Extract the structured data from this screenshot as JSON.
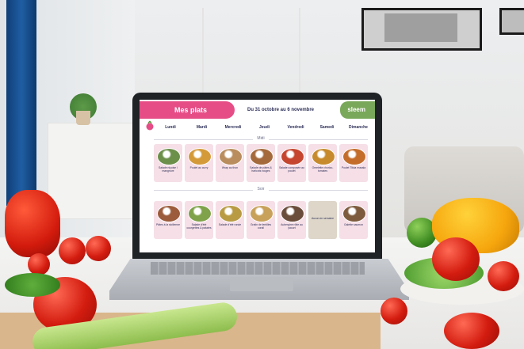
{
  "app": {
    "title": "Mes plats",
    "date_range": "Du 31 octobre au 6 novembre",
    "brand": "sleem"
  },
  "days": [
    "Lundi",
    "Mardi",
    "Mercredi",
    "Jeudi",
    "Vendredi",
    "Samedi",
    "Dimanche"
  ],
  "sections": {
    "midi": "Midi",
    "soir": "Soir"
  },
  "midi_meals": [
    {
      "label": "Salade niçoise / mangrove",
      "color": "#6c8f4a"
    },
    {
      "label": "Poulet au curry",
      "color": "#d49a3a"
    },
    {
      "label": "Wrap au thon",
      "color": "#b98d5d"
    },
    {
      "label": "Salade de pâtes & haricots rouges",
      "color": "#a56a3c"
    },
    {
      "label": "Salade composée au poulet",
      "color": "#c5452e"
    },
    {
      "label": "Omelette chorizo-tomates",
      "color": "#c78b2d"
    },
    {
      "label": "Poulet Tikka masala",
      "color": "#c46d2b"
    }
  ],
  "soir_meals": [
    {
      "label": "Pâtes à la sicilienne",
      "color": "#9c5b3b"
    },
    {
      "label": "Salade d'été courgettes & patates",
      "color": "#7fa24a"
    },
    {
      "label": "Salade d'été ronde",
      "color": "#b89b43"
    },
    {
      "label": "Gratin de lentilles corail",
      "color": "#c8a15a"
    },
    {
      "label": "Aubergine rôtie au yaourt",
      "color": "#6b4d3b"
    },
    {
      "label": "Aucun en semaine",
      "color": ""
    },
    {
      "label": "Galette saumon",
      "color": "#7e5b3d"
    }
  ],
  "colors": {
    "accent_pink": "#e64d86",
    "brand_green": "#7aa85a",
    "card_pink": "#f6dfe7",
    "text_navy": "#2c2e57"
  }
}
